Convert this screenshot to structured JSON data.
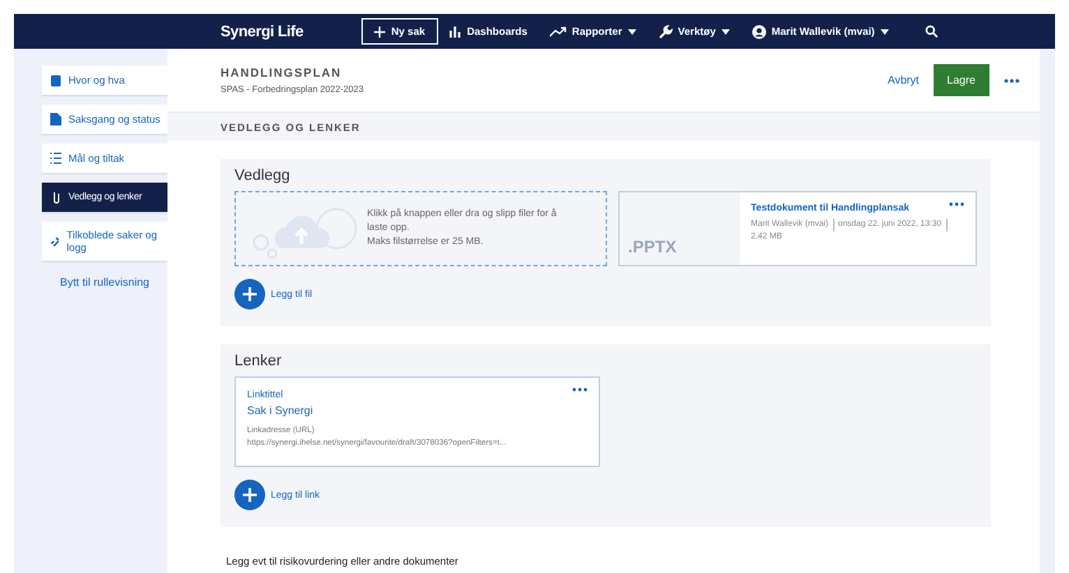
{
  "navbar": {
    "logo": "Synergi Life",
    "items": [
      {
        "label": "Ny sak",
        "kind": "button"
      },
      {
        "label": "Dashboards",
        "kind": "link"
      },
      {
        "label": "Rapporter",
        "kind": "dropdown"
      },
      {
        "label": "Verktøy",
        "kind": "dropdown"
      },
      {
        "label": "Marit Wallevik (mvai)",
        "kind": "dropdown"
      }
    ]
  },
  "sidebar": {
    "items": [
      {
        "label": "Hvor og hva",
        "selected": false
      },
      {
        "label": "Saksgang og status",
        "selected": false
      },
      {
        "label": "Mål og tiltak",
        "selected": false
      },
      {
        "label": "Vedlegg og lenker",
        "selected": true
      },
      {
        "label": "Tilkoblede saker og logg",
        "selected": false
      }
    ],
    "link": "Bytt til rullevisning"
  },
  "header": {
    "title": "HANDLINGSPLAN",
    "subtitle": "SPAS - Forbedringsplan 2022-2023",
    "cancel": "Avbryt",
    "save": "Lagre"
  },
  "section_heading": "VEDLEGG OG LENKER",
  "attachments": {
    "title": "Vedlegg",
    "dropzone": {
      "text": "Klikk på knappen eller dra og slipp filer for å laste opp.",
      "note": "Maks filstørrelse er 25 MB."
    },
    "files": [
      {
        "extension": ".PPTX",
        "name": "Testdokument til Handlingplansak",
        "meta": [
          "Marit Wallevik (mvai)",
          "onsdag 22. juni 2022, 13:30",
          "2.42 MB"
        ]
      }
    ],
    "add_label": "Legg til fil"
  },
  "links": {
    "title": "Lenker",
    "items": [
      {
        "title_label": "Linktittel",
        "title": "Sak i Synergi",
        "url_label": "Linkadresse (URL)",
        "url": "https://synergi.ihelse.net/synergi/favourite/draft/3078036?openFilters=t..."
      }
    ],
    "add_label": "Legg til link"
  },
  "footer_text": "Legg evt til risikovurdering eller andre dokumenter"
}
